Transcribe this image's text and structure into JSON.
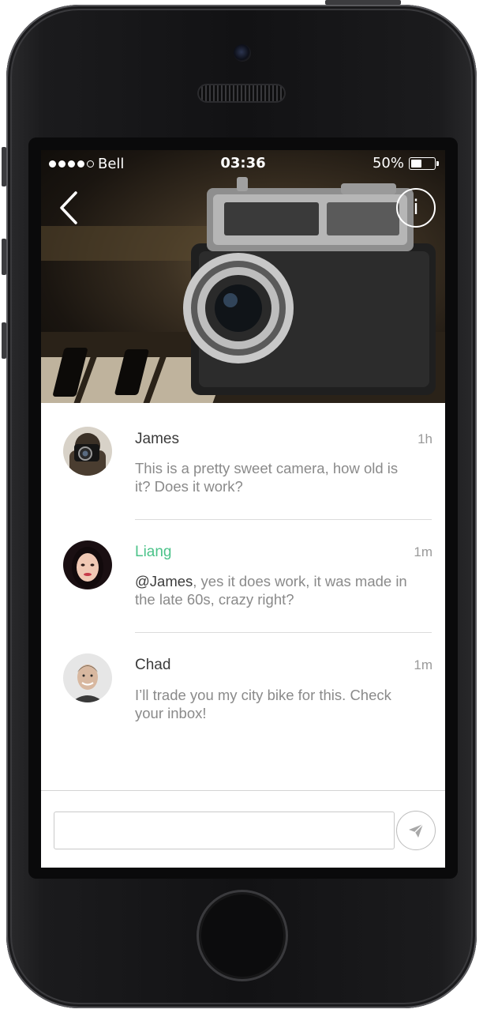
{
  "status_bar": {
    "signal_dots_filled": 4,
    "signal_dots_total": 5,
    "carrier": "Bell",
    "time": "03:36",
    "battery_text": "50%",
    "battery_level": 0.5
  },
  "header": {
    "back_icon": "chevron-left-icon",
    "info_label": "i"
  },
  "comments": [
    {
      "name": "James",
      "time": "1h",
      "text": "This is a pretty sweet camera, how old is it? Does it work?",
      "mention": "",
      "name_color": "#3b3b3b"
    },
    {
      "name": "Liang",
      "time": "1m",
      "text": ", yes it does work, it was made in the late 60s, crazy right?",
      "mention": "@James",
      "name_color": "#4cc38a"
    },
    {
      "name": "Chad",
      "time": "1m",
      "text": "I’ll trade you my city bike for this. Check your inbox!",
      "mention": "",
      "name_color": "#3b3b3b"
    }
  ],
  "composer": {
    "value": "",
    "placeholder": "",
    "send_icon": "paper-plane-icon"
  },
  "colors": {
    "accent": "#4cc38a",
    "text_dark": "#3b3b3b",
    "text_muted": "#8a8a8a"
  }
}
